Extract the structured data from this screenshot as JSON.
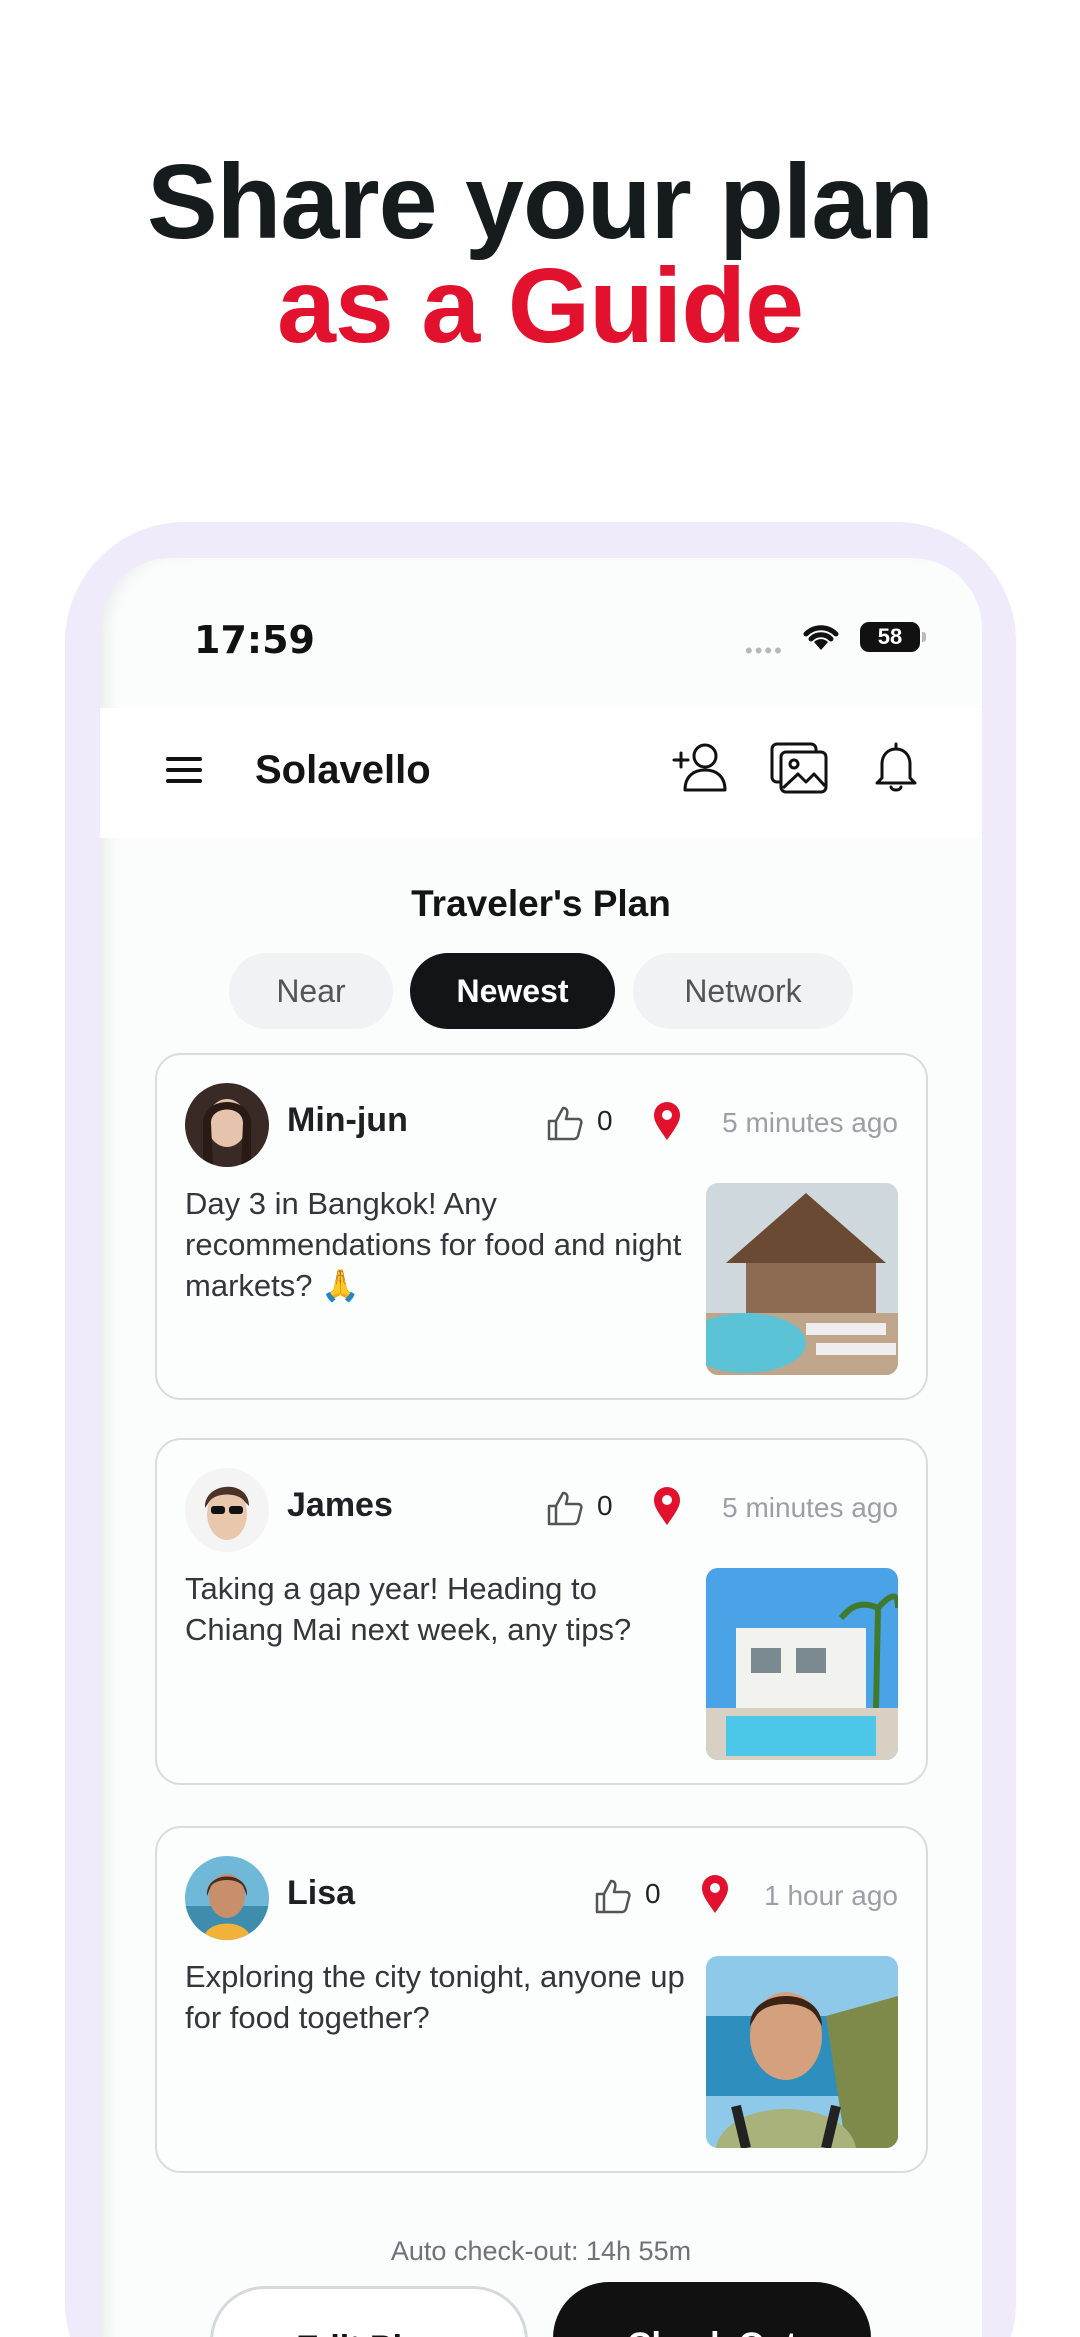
{
  "headline": {
    "line1": "Share your plan",
    "line2": "as a Guide"
  },
  "status_bar": {
    "time": "17:59",
    "battery": "58"
  },
  "app": {
    "title": "Solavello"
  },
  "section_title": "Traveler's Plan",
  "tabs": [
    {
      "label": "Near",
      "active": false
    },
    {
      "label": "Newest",
      "active": true
    },
    {
      "label": "Network",
      "active": false
    }
  ],
  "posts": [
    {
      "name": "Min-jun",
      "likes": "0",
      "time": "5 minutes ago",
      "text": "Day 3 in Bangkok! Any recommendations for food and night markets? 🙏"
    },
    {
      "name": "James",
      "likes": "0",
      "time": "5 minutes ago",
      "text": "Taking a gap year! Heading to Chiang Mai next week, any tips?"
    },
    {
      "name": "Lisa",
      "likes": "0",
      "time": "1 hour ago",
      "text": "Exploring the city tonight, anyone up for food together?"
    }
  ],
  "footer": {
    "auto_checkout": "Auto check-out: 14h 55m",
    "edit_label": "Edit Plan",
    "checkout_label": "Check Out"
  },
  "colors": {
    "accent_red": "#e2112d",
    "frame_lavender": "#efebfb",
    "dark": "#121517"
  }
}
